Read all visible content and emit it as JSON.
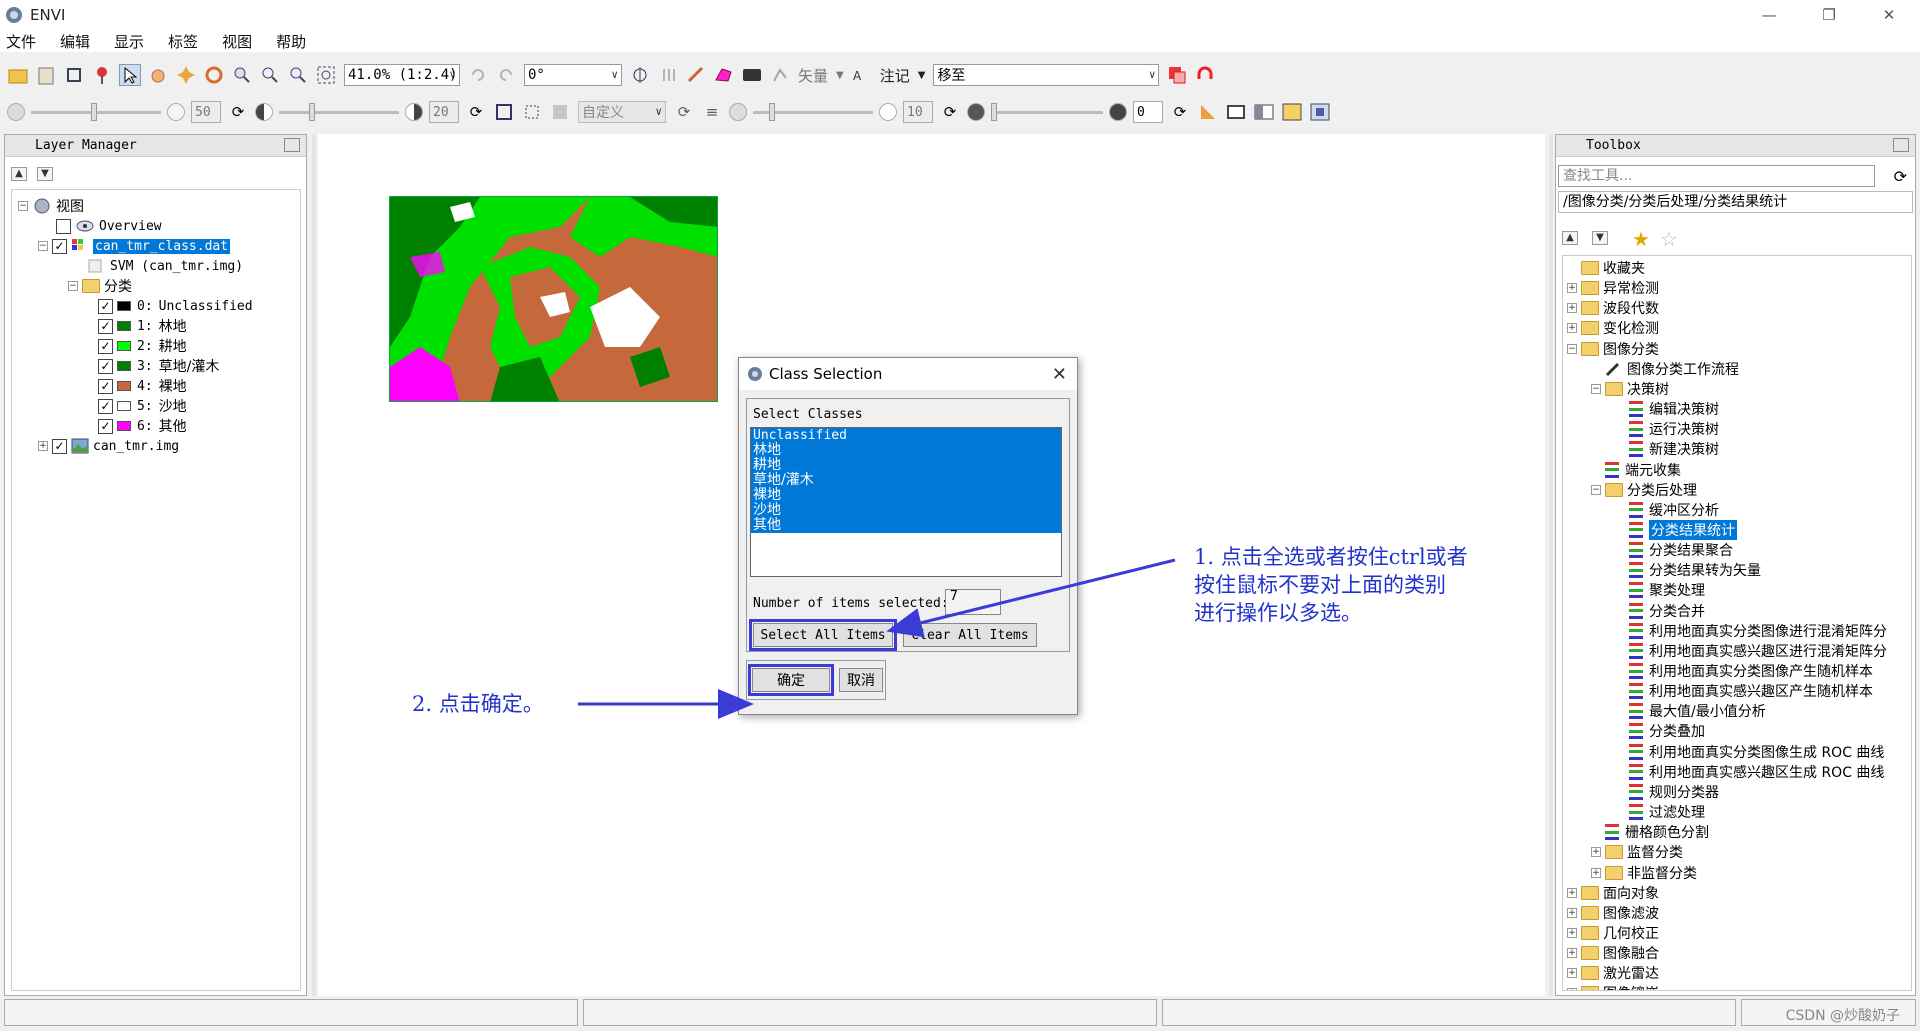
{
  "window": {
    "title": "ENVI"
  },
  "menu": [
    "文件",
    "编辑",
    "显示",
    "标签",
    "视图",
    "帮助"
  ],
  "toolbar1": {
    "zoom_value": "41.0% (1:2.4)",
    "rotation_value": "0°",
    "vector_label": "矢量",
    "annotation_label": "注记",
    "goto_value": "移至"
  },
  "toolbar2": {
    "brightness": "50",
    "contrast": "20",
    "stretch_value": "自定义",
    "sharpen": "10",
    "transparency": "0"
  },
  "layer_manager": {
    "header": "Layer Manager",
    "root_label": "视图",
    "overview_label": "Overview",
    "class_file_label": "can_tmr_class.dat",
    "svm_label": "SVM (can_tmr.img)",
    "classes_folder_label": "分类",
    "classes": [
      {
        "index": "0:",
        "name": "Unclassified",
        "color": "#000000"
      },
      {
        "index": "1:",
        "name": "林地",
        "color": "#008000"
      },
      {
        "index": "2:",
        "name": "耕地",
        "color": "#00ff00"
      },
      {
        "index": "3:",
        "name": "草地/灌木",
        "color": "#008000"
      },
      {
        "index": "4:",
        "name": "裸地",
        "color": "#c5683c"
      },
      {
        "index": "5:",
        "name": "沙地",
        "color": "#ffffff"
      },
      {
        "index": "6:",
        "name": "其他",
        "color": "#ff00ff"
      }
    ],
    "image_label": "can_tmr.img"
  },
  "dialog": {
    "title": "Class Selection",
    "group_label": "Select Classes",
    "items": [
      "Unclassified",
      "林地",
      "耕地",
      "草地/灌木",
      "裸地",
      "沙地",
      "其他"
    ],
    "count_label": "Number of items selected:",
    "count_value": "7",
    "select_all_label": "Select All Items",
    "clear_all_label": "Clear All Items",
    "ok_label": "确定",
    "cancel_label": "取消"
  },
  "annotations": {
    "step1": "1. 点击全选或者按住ctrl或者按住鼠标不要对上面的类别进行操作以多选。",
    "step1_lines": [
      "1. 点击全选或者按住ctrl或者",
      "按住鼠标不要对上面的类别",
      "进行操作以多选。"
    ],
    "step2": "2. 点击确定。"
  },
  "toolbox": {
    "header": "Toolbox",
    "search_placeholder": "查找工具...",
    "path": "/图像分类/分类后处理/分类结果统计",
    "top_items": [
      "收藏夹",
      "异常检测",
      "波段代数",
      "变化检测",
      "图像分类"
    ],
    "classification_children": [
      "图像分类工作流程",
      "决策树"
    ],
    "decision_tree_children": [
      "编辑决策树",
      "运行决策树",
      "新建决策树"
    ],
    "endmember_label": "端元收集",
    "postclass_label": "分类后处理",
    "postclass_children": [
      "缓冲区分析",
      "分类结果统计",
      "分类结果聚合",
      "分类结果转为矢量",
      "聚类处理",
      "分类合并",
      "利用地面真实分类图像进行混淆矩阵分",
      "利用地面真实感兴趣区进行混淆矩阵分",
      "利用地面真实分类图像产生随机样本",
      "利用地面真实感兴趣区产生随机样本",
      "最大值/最小值分析",
      "分类叠加",
      "利用地面真实分类图像生成 ROC 曲线",
      "利用地面真实感兴趣区生成 ROC 曲线",
      "规则分类器",
      "过滤处理"
    ],
    "raster_color_slice": "栅格颜色分割",
    "supervised_label": "监督分类",
    "unsupervised_label": "非监督分类",
    "bottom_items": [
      "面向对象",
      "图像滤波",
      "几何校正",
      "图像融合",
      "激光雷达",
      "图像镶嵌"
    ]
  },
  "watermark": "CSDN @炒酸奶子",
  "colors": {
    "selection": "#0078d7",
    "annotation": "#2233cc",
    "bare_soil": "#c5683c",
    "forest": "#008000",
    "farmland": "#00ff00",
    "other": "#ff00ff"
  }
}
